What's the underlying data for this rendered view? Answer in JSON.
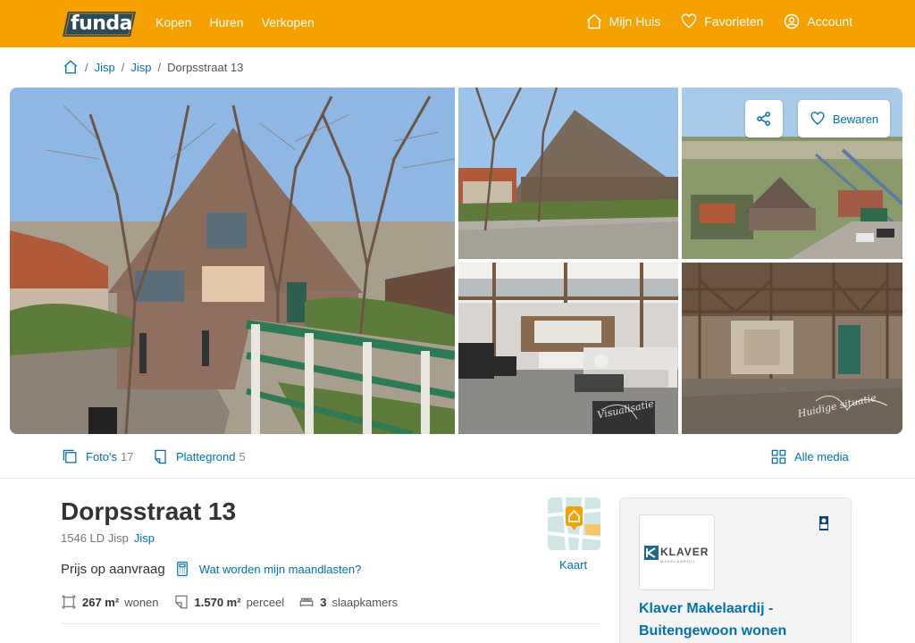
{
  "brand": {
    "name": "funda",
    "color": "#f7a100",
    "link_color": "#0071b3"
  },
  "nav": {
    "left": [
      "Kopen",
      "Huren",
      "Verkopen"
    ],
    "right": [
      {
        "label": "Mijn Huis",
        "icon": "home-icon"
      },
      {
        "label": "Favorieten",
        "icon": "heart-icon"
      },
      {
        "label": "Account",
        "icon": "user-icon"
      }
    ]
  },
  "breadcrumb": {
    "items": [
      "Jisp",
      "Jisp"
    ],
    "current": "Dorpsstraat 13"
  },
  "gallery": {
    "save_label": "Bewaren",
    "watermarks": [
      "Visualisatie",
      "Huidige situatie"
    ]
  },
  "media": {
    "photos": {
      "label": "Foto's",
      "count": "17"
    },
    "floorplan": {
      "label": "Plattegrond",
      "count": "5"
    },
    "all": "Alle media"
  },
  "listing": {
    "title": "Dorpsstraat 13",
    "postal": "1546 LD Jisp",
    "place_link": "Jisp",
    "price": "Prijs op aanvraag",
    "monthly_link": "Wat worden mijn maandlasten?",
    "map_label": "Kaart",
    "features": [
      {
        "value": "267 m²",
        "label": "wonen"
      },
      {
        "value": "1.570 m²",
        "label": "perceel"
      },
      {
        "value": "3",
        "label": "slaapkamers"
      }
    ]
  },
  "agent": {
    "logo_name": "KLAVER",
    "logo_sub": "MAKELAARDIJ",
    "name_line1": "Klaver Makelaardij -",
    "name_line2": "Buitengewoon wonen"
  }
}
